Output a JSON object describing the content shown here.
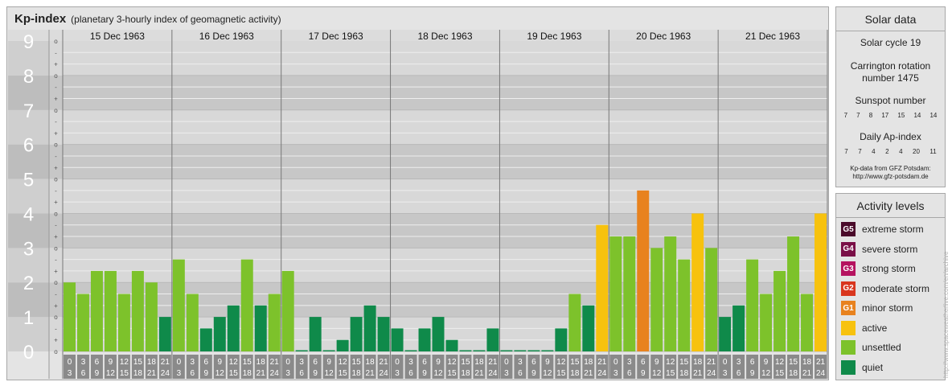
{
  "header": {
    "title": "Kp-index",
    "subtitle": "(planetary 3-hourly index of geomagnetic activity)"
  },
  "chart_data": {
    "type": "bar",
    "title": "Kp-index",
    "subtitle": "(planetary 3-hourly index of geomagnetic activity)",
    "ylim": [
      0,
      9
    ],
    "y_ticks": [
      "0",
      "1",
      "2",
      "3",
      "4",
      "5",
      "6",
      "7",
      "8",
      "9"
    ],
    "minor_ticks": [
      "o",
      "+",
      "-"
    ],
    "days": [
      "15 Dec 1963",
      "16 Dec 1963",
      "17 Dec 1963",
      "18 Dec 1963",
      "19 Dec 1963",
      "20 Dec 1963",
      "21 Dec 1963"
    ],
    "interval_start": [
      "0",
      "3",
      "6",
      "9",
      "12",
      "15",
      "18",
      "21"
    ],
    "interval_end": [
      "3",
      "6",
      "9",
      "12",
      "15",
      "18",
      "21",
      "24"
    ],
    "values": [
      [
        2.0,
        1.667,
        2.333,
        2.333,
        1.667,
        2.333,
        2.0,
        1.0
      ],
      [
        2.667,
        1.667,
        0.667,
        1.0,
        1.333,
        2.667,
        1.333,
        1.667
      ],
      [
        2.333,
        0.0,
        1.0,
        0.0,
        0.333,
        1.0,
        1.333,
        1.0
      ],
      [
        0.667,
        0.0,
        0.667,
        1.0,
        0.333,
        0.0,
        0.0,
        0.667
      ],
      [
        0.0,
        0.0,
        0.0,
        0.0,
        0.667,
        1.667,
        1.333,
        3.667
      ],
      [
        3.333,
        3.333,
        4.667,
        3.0,
        3.333,
        2.667,
        4.0,
        3.0
      ],
      [
        1.0,
        1.333,
        2.667,
        1.667,
        2.333,
        3.333,
        1.667,
        4.0
      ]
    ],
    "grid": true
  },
  "solar": {
    "title": "Solar data",
    "cycle": "Solar cycle 19",
    "carrington_line1": "Carrington rotation",
    "carrington_line2": "number 1475",
    "sunspot_label": "Sunspot number",
    "sunspot_values": [
      "7",
      "7",
      "8",
      "17",
      "15",
      "14",
      "14"
    ],
    "ap_label": "Daily Ap-index",
    "ap_values": [
      "7",
      "7",
      "4",
      "2",
      "4",
      "20",
      "11"
    ],
    "source_line1": "Kp-data from GFZ Potsdam:",
    "source_line2": "http://www.gfz-potsdam.de"
  },
  "legend": {
    "title": "Activity levels",
    "items": [
      {
        "code": "G5",
        "label": "extreme storm",
        "color": "#4a0a2a"
      },
      {
        "code": "G4",
        "label": "severe storm",
        "color": "#7a0f47"
      },
      {
        "code": "G3",
        "label": "strong storm",
        "color": "#b5125f"
      },
      {
        "code": "G2",
        "label": "moderate storm",
        "color": "#d9361e"
      },
      {
        "code": "G1",
        "label": "minor storm",
        "color": "#e8821e"
      },
      {
        "code": "",
        "label": "active",
        "color": "#f7c20e"
      },
      {
        "code": "",
        "label": "unsettled",
        "color": "#7dc22b"
      },
      {
        "code": "",
        "label": "quiet",
        "color": "#0f8a4a"
      }
    ]
  },
  "watermark": "http://www.spaceweatherlive.com/en/archive"
}
